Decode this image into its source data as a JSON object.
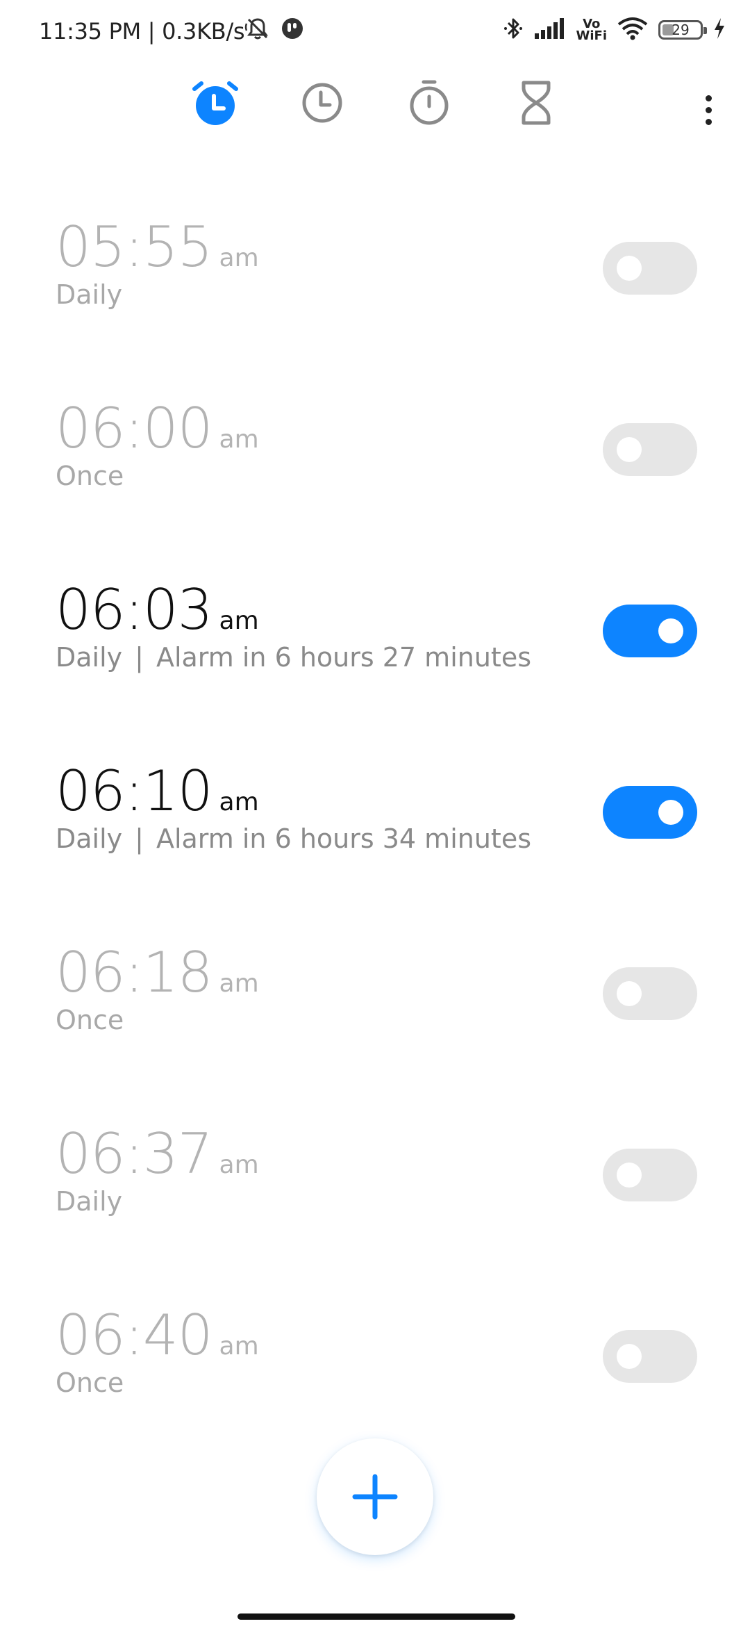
{
  "status_bar": {
    "time_speed": "11:35 PM | 0.3KB/s",
    "vowifi_top": "Vo",
    "vowifi_bottom": "WiFi",
    "battery_level": "29",
    "icons": [
      "bell-muted-icon",
      "app-notification-icon",
      "bluetooth-icon",
      "signal-icon",
      "vowifi-icon",
      "wifi-icon",
      "battery-icon",
      "charging-icon"
    ]
  },
  "tabs": [
    {
      "name": "alarm",
      "icon": "alarm-clock-icon",
      "selected": true
    },
    {
      "name": "clock",
      "icon": "clock-icon",
      "selected": false
    },
    {
      "name": "stopwatch",
      "icon": "stopwatch-icon",
      "selected": false
    },
    {
      "name": "timer",
      "icon": "hourglass-icon",
      "selected": false
    }
  ],
  "colors": {
    "accent": "#0d84ff",
    "toggle_off": "#e6e6e6",
    "text_on": "#111111",
    "text_off": "#b3b3b3"
  },
  "alarms": [
    {
      "time": "05:55",
      "ampm": "am",
      "repeat": "Daily",
      "separator": "",
      "countdown": "",
      "enabled": false
    },
    {
      "time": "06:00",
      "ampm": "am",
      "repeat": "Once",
      "separator": "",
      "countdown": "",
      "enabled": false
    },
    {
      "time": "06:03",
      "ampm": "am",
      "repeat": "Daily",
      "separator": "|",
      "countdown": "Alarm in 6 hours 27 minutes",
      "enabled": true
    },
    {
      "time": "06:10",
      "ampm": "am",
      "repeat": "Daily",
      "separator": "|",
      "countdown": "Alarm in 6 hours 34 minutes",
      "enabled": true
    },
    {
      "time": "06:18",
      "ampm": "am",
      "repeat": "Once",
      "separator": "",
      "countdown": "",
      "enabled": false
    },
    {
      "time": "06:37",
      "ampm": "am",
      "repeat": "Daily",
      "separator": "",
      "countdown": "",
      "enabled": false
    },
    {
      "time": "06:40",
      "ampm": "am",
      "repeat": "Once",
      "separator": "",
      "countdown": "",
      "enabled": false
    }
  ],
  "fab": {
    "icon": "plus-icon"
  }
}
